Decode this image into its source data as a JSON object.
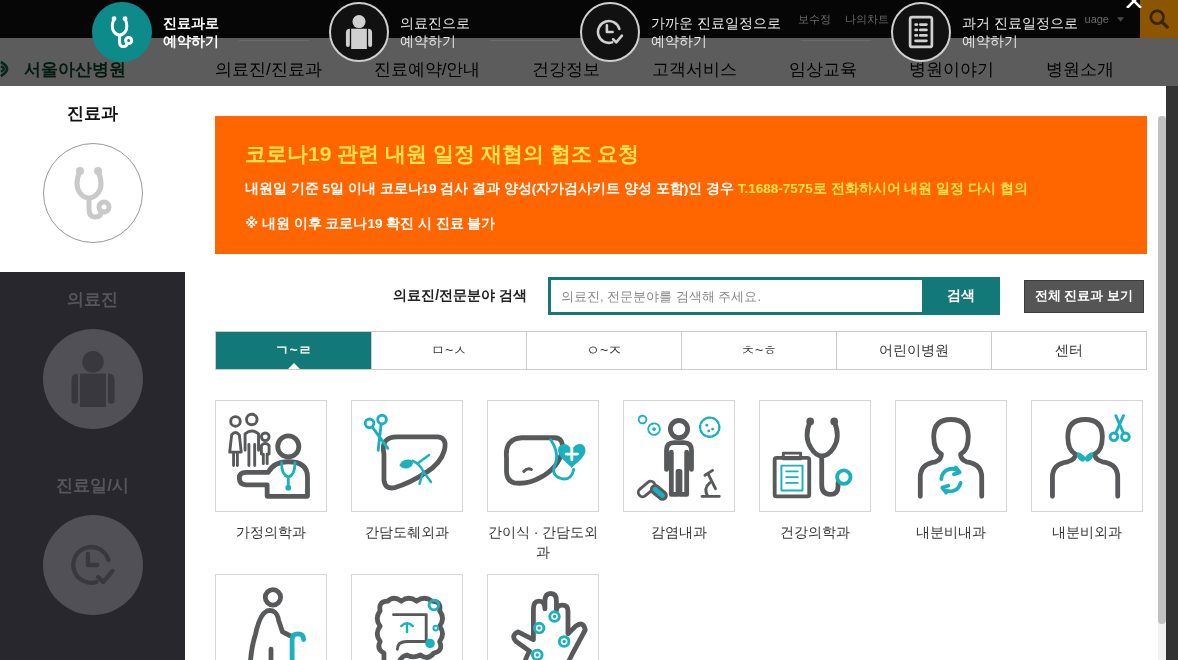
{
  "background_page": {
    "utility_links": [
      "보수정",
      "나의차트"
    ],
    "language": "uage",
    "logo": "서울아산병원",
    "nav": [
      "의료진/진료과",
      "진료예약/안내",
      "건강정보",
      "고객서비스",
      "임상교육",
      "병원이야기",
      "병원소개"
    ]
  },
  "steps": [
    {
      "label": "진료과로\n예약하기",
      "selected": true
    },
    {
      "label": "의료진으로\n예약하기",
      "selected": false
    },
    {
      "label": "가까운 진료일정으로\n예약하기",
      "selected": false
    },
    {
      "label": "과거 진료일정으로\n예약하기",
      "selected": false
    }
  ],
  "sidebar": {
    "items": [
      {
        "label": "진료과",
        "selected": true
      },
      {
        "label": "의료진",
        "selected": false
      },
      {
        "label": "진료일/시",
        "selected": false
      }
    ]
  },
  "notice": {
    "title": "코로나19 관련 내원 일정 재협의 협조 요청",
    "lines": [
      "내원일 기준 5일 이내 코로나19 검사 결과 양성(자가검사키트 양성 포함)인 경우 **T.1688-7575로 전화하시어 내원 일정 다시 협의**",
      "※ 내원 이후 코로나19 확진 시 진료 불가"
    ]
  },
  "search": {
    "label": "의료진/전문분야 검색",
    "placeholder": "의료진, 전문분야를 검색해 주세요.",
    "button": "검색"
  },
  "all_departments_button": "전체 진료과 보기",
  "tabs": [
    {
      "label": "ㄱ~ㄹ",
      "selected": true
    },
    {
      "label": "ㅁ~ㅅ",
      "selected": false
    },
    {
      "label": "ㅇ~ㅈ",
      "selected": false
    },
    {
      "label": "ㅊ~ㅎ",
      "selected": false
    },
    {
      "label": "어린이병원",
      "selected": false
    },
    {
      "label": "센터",
      "selected": false
    }
  ],
  "departments": [
    {
      "kind": "family",
      "label": "가정의학과"
    },
    {
      "kind": "liver",
      "label": "간담도췌외과"
    },
    {
      "kind": "transplant",
      "label": "간이식 · 간담도외과"
    },
    {
      "kind": "infection",
      "label": "감염내과"
    },
    {
      "kind": "checkup",
      "label": "건강의학과"
    },
    {
      "kind": "endocrine",
      "label": "내분비내과"
    },
    {
      "kind": "thyroid",
      "label": "내분비외과"
    },
    {
      "kind": "elderly"
    },
    {
      "kind": "colon"
    },
    {
      "kind": "joint"
    }
  ]
}
